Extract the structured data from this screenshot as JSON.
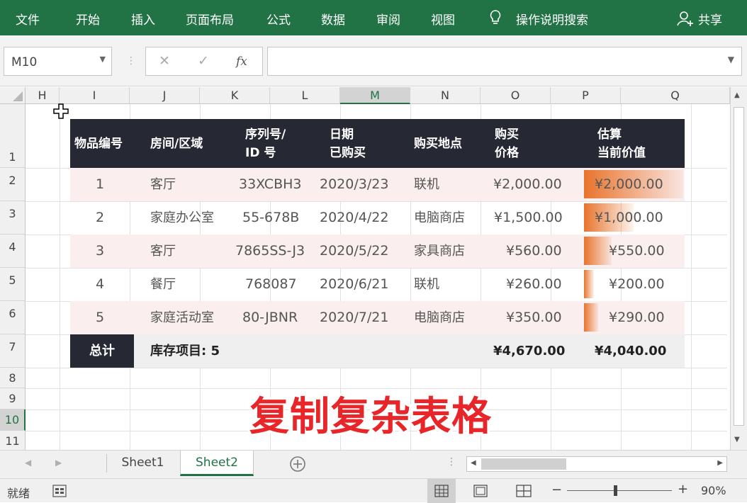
{
  "ribbon": {
    "tabs": [
      "文件",
      "开始",
      "插入",
      "页面布局",
      "公式",
      "数据",
      "审阅",
      "视图"
    ],
    "search_label": "操作说明搜索",
    "share_label": "共享"
  },
  "formula_bar": {
    "name_box": "M10",
    "cancel_symbol": "✕",
    "enter_symbol": "✓",
    "fx_symbol": "fx",
    "value": ""
  },
  "grid": {
    "columns": [
      "H",
      "I",
      "J",
      "K",
      "L",
      "M",
      "N",
      "O",
      "P",
      "Q"
    ],
    "rows": [
      "1",
      "2",
      "3",
      "4",
      "5",
      "6",
      "7",
      "8",
      "9",
      "10",
      "11"
    ],
    "selected_column": "M",
    "selected_row": "10"
  },
  "table": {
    "headers": [
      [
        "物品编号"
      ],
      [
        "房间/区域"
      ],
      [
        "序列号/",
        "ID 号"
      ],
      [
        "日期",
        "已购买"
      ],
      [
        "购买地点"
      ],
      [
        "购买",
        "价格"
      ],
      [
        "估算",
        "当前价值"
      ]
    ],
    "rows": [
      {
        "id": "1",
        "room": "客厅",
        "serial": "33XCBH3",
        "date": "2020/3/23",
        "place": "联机",
        "price": "¥2,000.00",
        "value": "¥2,000.00",
        "bar": 1.0
      },
      {
        "id": "2",
        "room": "家庭办公室",
        "serial": "55-678B",
        "date": "2020/4/22",
        "place": "电脑商店",
        "price": "¥1,500.00",
        "value": "¥1,000.00",
        "bar": 0.5
      },
      {
        "id": "3",
        "room": "客厅",
        "serial": "7865SS-J3",
        "date": "2020/5/22",
        "place": "家具商店",
        "price": "¥560.00",
        "value": "¥550.00",
        "bar": 0.275
      },
      {
        "id": "4",
        "room": "餐厅",
        "serial": "768087",
        "date": "2020/6/21",
        "place": "联机",
        "price": "¥260.00",
        "value": "¥200.00",
        "bar": 0.1
      },
      {
        "id": "5",
        "room": "家庭活动室",
        "serial": "80-JBNR",
        "date": "2020/7/21",
        "place": "电脑商店",
        "price": "¥350.00",
        "value": "¥290.00",
        "bar": 0.145
      }
    ],
    "total": {
      "label": "总计",
      "items": "库存项目: 5",
      "price": "¥4,670.00",
      "value": "¥4,040.00"
    }
  },
  "caption": "复制复杂表格",
  "sheet_tabs": [
    "Sheet1",
    "Sheet2"
  ],
  "active_sheet": "Sheet2",
  "status": {
    "ready": "就绪",
    "zoom": "90%"
  },
  "colors": {
    "ribbon": "#217346",
    "header_dark": "#262834",
    "row_pink": "#faeeee",
    "databar": "#e8742c",
    "caption": "#e8262a"
  }
}
